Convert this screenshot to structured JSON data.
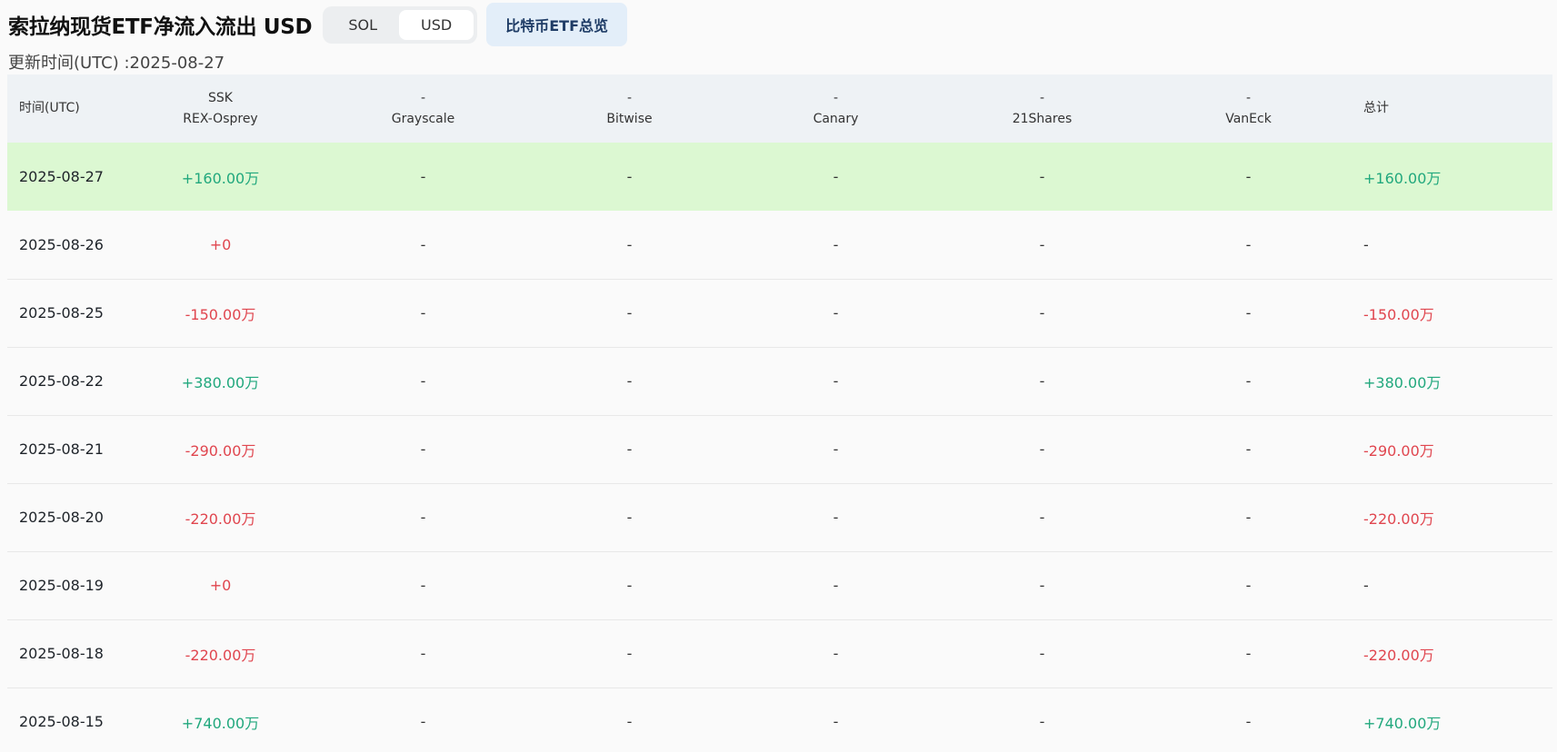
{
  "title": "索拉纳现货ETF净流入流出 USD",
  "currency_toggle": {
    "options": [
      "SOL",
      "USD"
    ],
    "selected": "USD"
  },
  "overview_button": "比特币ETF总览",
  "update_time": "更新时间(UTC) :2025-08-27",
  "table": {
    "headers": [
      {
        "top": "",
        "bottom": "时间(UTC)"
      },
      {
        "top": "SSK",
        "bottom": "REX-Osprey"
      },
      {
        "top": "-",
        "bottom": "Grayscale"
      },
      {
        "top": "-",
        "bottom": "Bitwise"
      },
      {
        "top": "-",
        "bottom": "Canary"
      },
      {
        "top": "-",
        "bottom": "21Shares"
      },
      {
        "top": "-",
        "bottom": "VanEck"
      },
      {
        "top": "",
        "bottom": "总计"
      }
    ],
    "rows": [
      {
        "date": "2025-08-27",
        "ssk": "+160.00万",
        "grayscale": "-",
        "bitwise": "-",
        "canary": "-",
        "shares21": "-",
        "vaneck": "-",
        "total": "+160.00万",
        "highlight": true
      },
      {
        "date": "2025-08-26",
        "ssk": "+0",
        "grayscale": "-",
        "bitwise": "-",
        "canary": "-",
        "shares21": "-",
        "vaneck": "-",
        "total": "-"
      },
      {
        "date": "2025-08-25",
        "ssk": "-150.00万",
        "grayscale": "-",
        "bitwise": "-",
        "canary": "-",
        "shares21": "-",
        "vaneck": "-",
        "total": "-150.00万"
      },
      {
        "date": "2025-08-22",
        "ssk": "+380.00万",
        "grayscale": "-",
        "bitwise": "-",
        "canary": "-",
        "shares21": "-",
        "vaneck": "-",
        "total": "+380.00万"
      },
      {
        "date": "2025-08-21",
        "ssk": "-290.00万",
        "grayscale": "-",
        "bitwise": "-",
        "canary": "-",
        "shares21": "-",
        "vaneck": "-",
        "total": "-290.00万"
      },
      {
        "date": "2025-08-20",
        "ssk": "-220.00万",
        "grayscale": "-",
        "bitwise": "-",
        "canary": "-",
        "shares21": "-",
        "vaneck": "-",
        "total": "-220.00万"
      },
      {
        "date": "2025-08-19",
        "ssk": "+0",
        "grayscale": "-",
        "bitwise": "-",
        "canary": "-",
        "shares21": "-",
        "vaneck": "-",
        "total": "-"
      },
      {
        "date": "2025-08-18",
        "ssk": "-220.00万",
        "grayscale": "-",
        "bitwise": "-",
        "canary": "-",
        "shares21": "-",
        "vaneck": "-",
        "total": "-220.00万"
      },
      {
        "date": "2025-08-15",
        "ssk": "+740.00万",
        "grayscale": "-",
        "bitwise": "-",
        "canary": "-",
        "shares21": "-",
        "vaneck": "-",
        "total": "+740.00万"
      }
    ]
  },
  "colors": {
    "positive": "#21a87d",
    "negative": "#e0464f",
    "highlight_row": "#dcf8d2"
  }
}
